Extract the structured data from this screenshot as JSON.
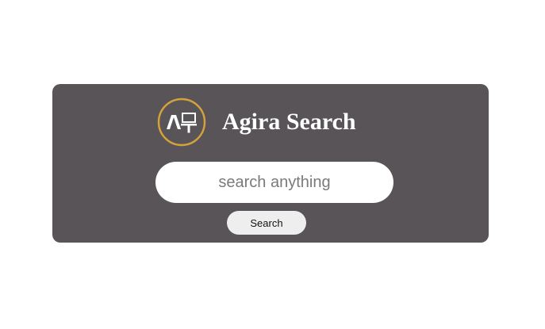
{
  "app": {
    "title": "Agira Search",
    "logo_icon": "agira-logo-icon",
    "accent_color": "#d4a23a",
    "card_color": "#585458"
  },
  "search": {
    "placeholder": "search anything",
    "value": "",
    "button_label": "Search"
  }
}
